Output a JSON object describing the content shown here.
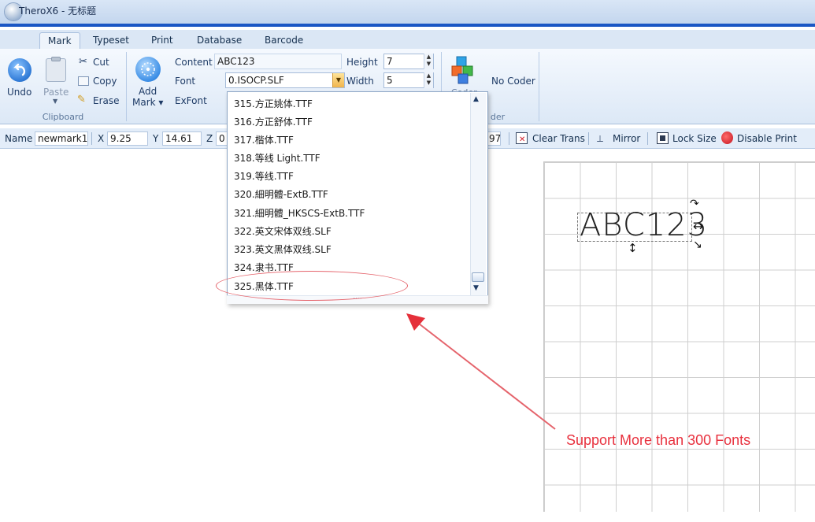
{
  "window": {
    "title": "TheroX6 - 无标题"
  },
  "tabs": [
    "Mark",
    "Typeset",
    "Print",
    "Database",
    "Barcode"
  ],
  "ribbon": {
    "clipboard": {
      "undo": "Undo",
      "paste": "Paste",
      "cut": "Cut",
      "copy": "Copy",
      "erase": "Erase",
      "group_label": "Clipboard"
    },
    "mark": {
      "add_mark_line1": "Add",
      "add_mark_line2": "Mark ▾",
      "content_label": "Content",
      "content_value": "ABC123",
      "font_label": "Font",
      "font_value": "0.ISOCP.SLF",
      "exfont_label": "ExFont",
      "height_label": "Height",
      "height_value": "7",
      "width_label": "Width",
      "width_value": "5"
    },
    "coder": {
      "coder_button": "Coder",
      "no_coder": "No Coder",
      "group_label_partial": "der"
    }
  },
  "propbar": {
    "name_label": "Name",
    "name_value": "newmark1",
    "x_label": "X",
    "x_value": "9.25",
    "y_label": "Y",
    "y_value": "14.61",
    "z_label": "Z",
    "z_value": "0",
    "partial_value": "97",
    "clear_trans": "Clear Trans",
    "mirror": "Mirror",
    "lock_size": "Lock Size",
    "disable_print": "Disable Print"
  },
  "font_dropdown": {
    "items": [
      "315.方正姚体.TTF",
      "316.方正舒体.TTF",
      "317.楷体.TTF",
      "318.等线 Light.TTF",
      "319.等线.TTF",
      "320.細明體-ExtB.TTF",
      "321.細明體_HKSCS-ExtB.TTF",
      "322.英文宋体双线.SLF",
      "323.英文黑体双线.SLF",
      "324.隶书.TTF",
      "325.黑体.TTF"
    ],
    "grip": "····"
  },
  "canvas": {
    "mark_text": "ABC123"
  },
  "annotation": {
    "text": "Support More than 300 Fonts",
    "color": "#e8313e"
  },
  "icons": [
    "app-icon",
    "undo-icon",
    "paste-icon",
    "cut-icon",
    "copy-icon",
    "erase-icon",
    "add-mark-icon",
    "coder-icon",
    "clear-trans-icon",
    "mirror-icon",
    "lock-size-icon",
    "disable-print-icon"
  ]
}
